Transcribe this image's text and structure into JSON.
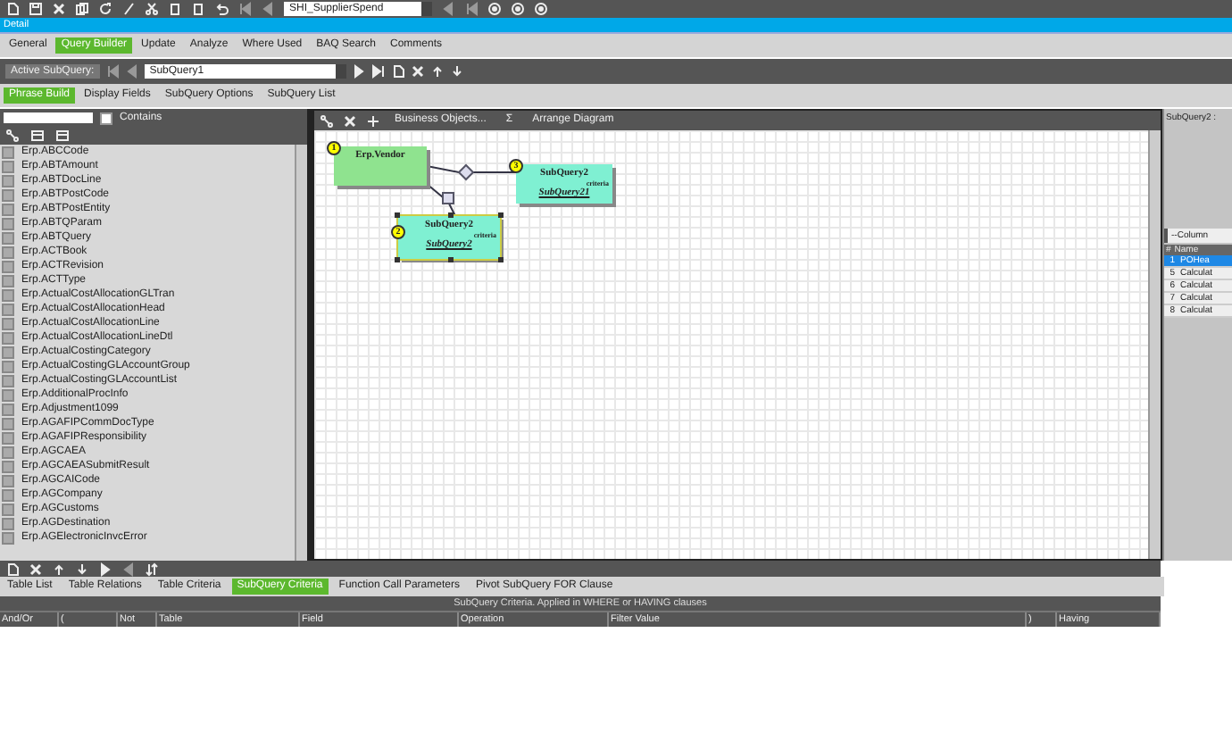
{
  "toolbar": {
    "query_combo": "SHI_SupplierSpend"
  },
  "window": {
    "title": "Detail"
  },
  "tabs": [
    {
      "label": "General",
      "selected": false
    },
    {
      "label": "Query Builder",
      "selected": true
    },
    {
      "label": "Update",
      "selected": false
    },
    {
      "label": "Analyze",
      "selected": false
    },
    {
      "label": "Where Used",
      "selected": false
    },
    {
      "label": "BAQ Search",
      "selected": false
    },
    {
      "label": "Comments",
      "selected": false
    }
  ],
  "subquery_bar": {
    "label": "Active SubQuery:",
    "value": "SubQuery1"
  },
  "subtabs": [
    {
      "label": "Phrase Build",
      "selected": true
    },
    {
      "label": "Display Fields",
      "selected": false
    },
    {
      "label": "SubQuery Options",
      "selected": false
    },
    {
      "label": "SubQuery List",
      "selected": false
    }
  ],
  "table_search": {
    "contains_label": "Contains",
    "contains_checked": false
  },
  "tables": [
    "Erp.ABCCode",
    "Erp.ABTAmount",
    "Erp.ABTDocLine",
    "Erp.ABTPostCode",
    "Erp.ABTPostEntity",
    "Erp.ABTQParam",
    "Erp.ABTQuery",
    "Erp.ACTBook",
    "Erp.ACTRevision",
    "Erp.ACTType",
    "Erp.ActualCostAllocationGLTran",
    "Erp.ActualCostAllocationHead",
    "Erp.ActualCostAllocationLine",
    "Erp.ActualCostAllocationLineDtl",
    "Erp.ActualCostingCategory",
    "Erp.ActualCostingGLAccountGroup",
    "Erp.ActualCostingGLAccountList",
    "Erp.AdditionalProcInfo",
    "Erp.Adjustment1099",
    "Erp.AGAFIPCommDocType",
    "Erp.AGAFIPResponsibility",
    "Erp.AGCAEA",
    "Erp.AGCAEASubmitResult",
    "Erp.AGCAICode",
    "Erp.AGCompany",
    "Erp.AGCustoms",
    "Erp.AGDestination",
    "Erp.AGElectronicInvcError"
  ],
  "diagram_toolbar": {
    "business_objects": "Business Objects...",
    "sigma": "Σ",
    "arrange": "Arrange Diagram"
  },
  "diagram_nodes": [
    {
      "number": "1",
      "kind": "table",
      "title": "Erp.Vendor",
      "selected": false
    },
    {
      "number": "3",
      "kind": "subquery",
      "title": "SubQuery2",
      "note": "criteria",
      "link": "SubQuery21",
      "selected": false
    },
    {
      "number": "2",
      "kind": "subquery",
      "title": "SubQuery2",
      "note": "criteria",
      "link": "SubQuery2",
      "selected": true
    }
  ],
  "properties_panel": {
    "title": "SubQuery2 :",
    "column_combo": "--Column",
    "columns": [
      "#",
      "Name"
    ],
    "rows": [
      {
        "number": "1",
        "name": "POHea",
        "selected": true
      },
      {
        "number": "5",
        "name": "Calculat",
        "selected": false
      },
      {
        "number": "6",
        "name": "Calculat",
        "selected": false
      },
      {
        "number": "7",
        "name": "Calculat",
        "selected": false
      },
      {
        "number": "8",
        "name": "Calculat",
        "selected": false
      }
    ]
  },
  "bottom_tabs": [
    {
      "label": "Table List",
      "selected": false
    },
    {
      "label": "Table Relations",
      "selected": false
    },
    {
      "label": "Table Criteria",
      "selected": false
    },
    {
      "label": "SubQuery Criteria",
      "selected": true
    },
    {
      "label": "Function Call Parameters",
      "selected": false
    },
    {
      "label": "Pivot SubQuery FOR Clause",
      "selected": false
    }
  ],
  "criteria_grid": {
    "caption": "SubQuery Criteria. Applied in WHERE or HAVING clauses",
    "columns": [
      "And/Or",
      "(",
      "Not",
      "Table",
      "Field",
      "Operation",
      "Filter Value",
      ")",
      "Having"
    ]
  }
}
